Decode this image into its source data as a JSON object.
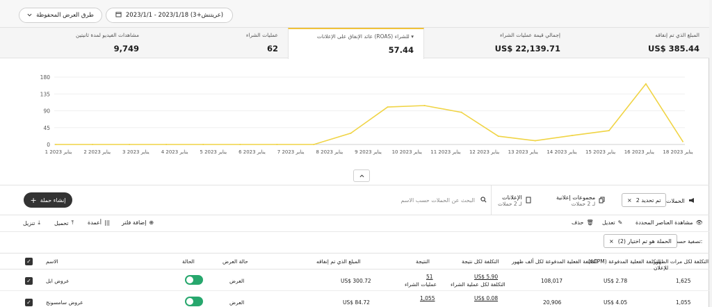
{
  "topbar": {
    "date_range": "2023/1/1 - 2023/1/18 (عريتنش+3)",
    "calendar_icon": "calendar-icon",
    "saved_views": "طرق العرض المحفوظة",
    "chevron_icon": "chevron-down-icon"
  },
  "kpis": [
    {
      "label": "المبلغ الذي تم إنفاقه",
      "value": "US$ 385.44"
    },
    {
      "label": "إجمالي قيمة عمليات الشراء",
      "value": "US$ 22,139.71"
    },
    {
      "label": "عائد الإنفاق على الإعلانات (ROAS) للشراء",
      "value": "57.44"
    },
    {
      "label": "عمليات الشراء",
      "value": "62"
    },
    {
      "label": "مشاهدات الفيديو لمدة ثانيتين",
      "value": "9,749"
    }
  ],
  "chart_data": {
    "type": "line",
    "categories": [
      "1 يناير 2023",
      "2 يناير 2023",
      "3 يناير 2023",
      "4 يناير 2023",
      "5 يناير 2023",
      "6 يناير 2023",
      "7 يناير 2023",
      "8 يناير 2023",
      "9 يناير 2023",
      "10 يناير 2023",
      "11 يناير 2023",
      "12 يناير 2023",
      "13 يناير 2023",
      "14 يناير 2023",
      "15 يناير 2023",
      "16 يناير 2023",
      "18 يناير 2023"
    ],
    "values": [
      0,
      0,
      0,
      0,
      0,
      0,
      0,
      0,
      30,
      100,
      104,
      86,
      22,
      10,
      24,
      37,
      162,
      8
    ],
    "yticks": [
      "180",
      "135",
      "90",
      "45",
      "0"
    ],
    "ylim": [
      0,
      180
    ],
    "color": "#f0d445"
  },
  "toolbar": {
    "create_label": "إنشاء حملة",
    "plus_icon": "plus-icon",
    "search_placeholder": "البحث عن الحملات حسب الاسم",
    "search_icon": "search-icon"
  },
  "tabs": {
    "campaigns": "الحملات",
    "selected_chip": "تم تحديد 2",
    "adsets": "مجموعات إعلانية",
    "adsets_sub": "لـ 2 حملات",
    "ads": "الإعلانات",
    "ads_sub": "لـ 2 حملات"
  },
  "actions": {
    "view_selected": "مشاهدة العناصر المحددة",
    "edit": "تعديل",
    "delete": "حذف",
    "add_filter": "إضافة فلتر",
    "columns": "أعمدة",
    "upload": "تحميل",
    "download": "تنزيل"
  },
  "filter": {
    "label": "تصفية حسب:",
    "chip": "الحملة هو تم اختيار (2)"
  },
  "table": {
    "headers": {
      "name": "الاسم",
      "status": "الحالة",
      "delivery": "حالة العرض",
      "spent": "المبلغ الذي تم إنفاقه",
      "result": "النتيجة",
      "cost_per_result": "التكلفة لكل نتيجة",
      "actual_cost": "التكلفة الفعلية المدفوعة لكل ألف ظهور",
      "cpm": "(eCPM) التكلفة الفعلية المدفوعة",
      "per_reach": "التكلفة لكل مرات الظهور للإعلان"
    },
    "rows": [
      {
        "name": "عروض ابل",
        "delivery": "العرض",
        "spent": "US$ 300.72",
        "result": "51",
        "result_sub": "عمليات الشراء",
        "cost": "US$ 5.90",
        "cost_sub": "التكلفة لكل عملية الشراء",
        "actual": "108,017",
        "cpm": "US$ 2.78",
        "reach": "1,625"
      },
      {
        "name": "عروض سامسونج",
        "delivery": "العرض",
        "spent": "US$ 84.72",
        "result": "1,055",
        "result_sub": "",
        "cost": "US$ 0.08",
        "cost_sub": "",
        "actual": "20,906",
        "cpm": "US$ 4.05",
        "reach": "1,055"
      }
    ]
  }
}
